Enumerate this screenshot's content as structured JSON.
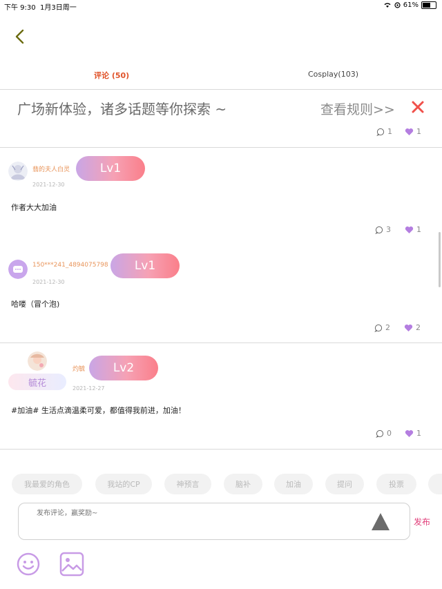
{
  "status_bar": {
    "time": "下午 9:30",
    "date": "1月3日周一",
    "battery_text": "61%",
    "battery_level": 0.61
  },
  "tabs": [
    {
      "label": "评论 (50)",
      "active": true
    },
    {
      "label": "Cosplay(103)",
      "active": false
    }
  ],
  "banner": {
    "text": "广场新体验，诸多话题等你探索 ~",
    "rules_link": "查看规则>>",
    "comment_count": "1",
    "like_count": "1"
  },
  "comments": [
    {
      "username": "翡的夫人白灵",
      "level": "Lv1",
      "date": "2021-12-30",
      "text": "作者大大加油",
      "comment_count": "3",
      "like_count": "1"
    },
    {
      "username": "150***241_4894075798",
      "level": "Lv1",
      "date": "2021-12-30",
      "text": "哈喽（冒个泡)",
      "comment_count": "2",
      "like_count": "2"
    },
    {
      "username": "灼毓",
      "badge_text": "毓花",
      "level": "Lv2",
      "date": "2021-12-27",
      "text": "#加油# 生活点滴温柔可爱，都值得我前进，加油！",
      "comment_count": "0",
      "like_count": "1"
    }
  ],
  "quick_tags": [
    "我最爱的角色",
    "我站的CP",
    "神预言",
    "脑补",
    "加油",
    "提问",
    "投票"
  ],
  "composer": {
    "placeholder": "发布评论，赢奖励~",
    "publish_label": "发布"
  },
  "colors": {
    "accent_tab": "#e0542b",
    "publish": "#e03c78",
    "heart": "#b47ee0",
    "username": "#e8945a",
    "icon_purple": "#c89be6"
  },
  "icons": [
    "back-chevron-icon",
    "close-x-icon",
    "comment-bubble-icon",
    "heart-icon",
    "emoji-icon",
    "image-icon",
    "send-triangle-icon"
  ]
}
